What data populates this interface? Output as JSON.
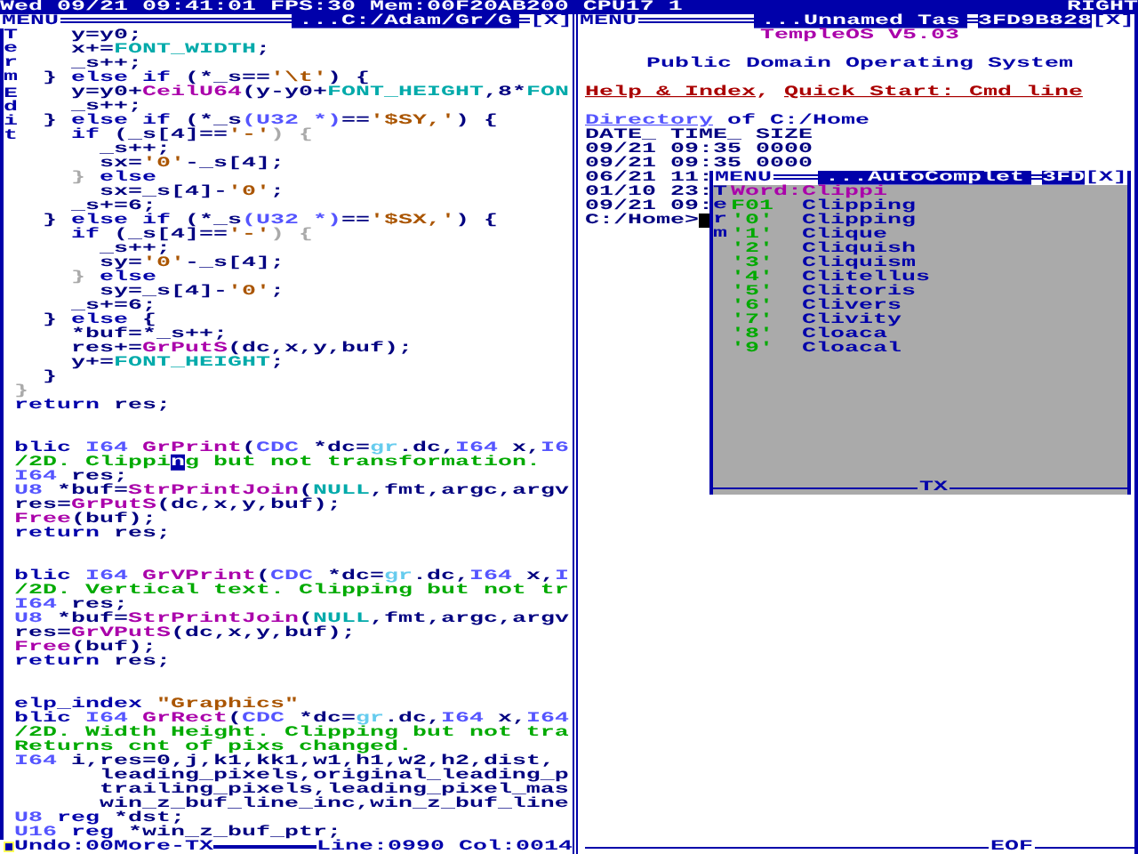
{
  "top_bar": {
    "status": "Wed 09/21 09:41:01 FPS:30 Mem:00F20AB200 CPU17 1",
    "right": "RIGHT"
  },
  "editor_window": {
    "menu": "MENU",
    "title": "...C:/Adam/Gr/G",
    "close": "[X]",
    "side_labels": [
      "Term",
      "Edit"
    ],
    "code_blocks": [
      [
        [
          {
            "text": "    y=y0;",
            "kind": "plain"
          }
        ],
        [
          {
            "text": "    x+=",
            "kind": "plain"
          },
          {
            "text": "FONT_WIDTH",
            "kind": "const"
          },
          {
            "text": ";",
            "kind": "plain"
          }
        ],
        [
          {
            "text": "    _s++;",
            "kind": "plain"
          }
        ],
        [
          {
            "text": "  } ",
            "kind": "plain"
          },
          {
            "text": "else if",
            "kind": "kw"
          },
          {
            "text": " (*_s==",
            "kind": "plain"
          },
          {
            "text": "'\\t'",
            "kind": "str"
          },
          {
            "text": ") {",
            "kind": "plain"
          }
        ],
        [
          {
            "text": "    y=y0+",
            "kind": "plain"
          },
          {
            "text": "CeilU64",
            "kind": "func"
          },
          {
            "text": "(y-y0+",
            "kind": "plain"
          },
          {
            "text": "FONT_HEIGHT",
            "kind": "const"
          },
          {
            "text": ",8*",
            "kind": "plain"
          },
          {
            "text": "FON",
            "kind": "const"
          }
        ],
        [
          {
            "text": "    _s++;",
            "kind": "plain"
          }
        ],
        [
          {
            "text": "  } ",
            "kind": "plain"
          },
          {
            "text": "else if",
            "kind": "kw"
          },
          {
            "text": " (*_s",
            "kind": "plain"
          },
          {
            "text": "(U32 *)",
            "kind": "type"
          },
          {
            "text": "==",
            "kind": "plain"
          },
          {
            "text": "'$SY,'",
            "kind": "str"
          },
          {
            "text": ") {",
            "kind": "plain"
          }
        ],
        [
          {
            "text": "    if",
            "kind": "kw"
          },
          {
            "text": " (_s[4]==",
            "kind": "plain"
          },
          {
            "text": "'-'",
            "kind": "str"
          },
          {
            "text": ") {",
            "kind": "dim"
          }
        ],
        [
          {
            "text": "      _s++;",
            "kind": "plain"
          }
        ],
        [
          {
            "text": "      sx=",
            "kind": "plain"
          },
          {
            "text": "'0'",
            "kind": "str"
          },
          {
            "text": "-_s[4];",
            "kind": "plain"
          }
        ],
        [
          {
            "text": "    } ",
            "kind": "dim"
          },
          {
            "text": "else",
            "kind": "kw"
          }
        ],
        [
          {
            "text": "      sx=_s[4]-",
            "kind": "plain"
          },
          {
            "text": "'0'",
            "kind": "str"
          },
          {
            "text": ";",
            "kind": "plain"
          }
        ],
        [
          {
            "text": "    _s+=6;",
            "kind": "plain"
          }
        ],
        [
          {
            "text": "  } ",
            "kind": "plain"
          },
          {
            "text": "else if",
            "kind": "kw"
          },
          {
            "text": " (*_s",
            "kind": "plain"
          },
          {
            "text": "(U32 *)",
            "kind": "type"
          },
          {
            "text": "==",
            "kind": "plain"
          },
          {
            "text": "'$SX,'",
            "kind": "str"
          },
          {
            "text": ") {",
            "kind": "plain"
          }
        ],
        [
          {
            "text": "    if",
            "kind": "kw"
          },
          {
            "text": " (_s[4]==",
            "kind": "plain"
          },
          {
            "text": "'-'",
            "kind": "str"
          },
          {
            "text": ") {",
            "kind": "dim"
          }
        ],
        [
          {
            "text": "      _s++;",
            "kind": "plain"
          }
        ],
        [
          {
            "text": "      sy=",
            "kind": "plain"
          },
          {
            "text": "'0'",
            "kind": "str"
          },
          {
            "text": "-_s[4];",
            "kind": "plain"
          }
        ],
        [
          {
            "text": "    } ",
            "kind": "dim"
          },
          {
            "text": "else",
            "kind": "kw"
          }
        ],
        [
          {
            "text": "      sy=_s[4]-",
            "kind": "plain"
          },
          {
            "text": "'0'",
            "kind": "str"
          },
          {
            "text": ";",
            "kind": "plain"
          }
        ],
        [
          {
            "text": "    _s+=6;",
            "kind": "plain"
          }
        ],
        [
          {
            "text": "  } ",
            "kind": "plain"
          },
          {
            "text": "else",
            "kind": "kw"
          },
          {
            "text": " {",
            "kind": "plain"
          }
        ],
        [
          {
            "text": "    *buf=*_s++;",
            "kind": "plain"
          }
        ],
        [
          {
            "text": "    res+=",
            "kind": "plain"
          },
          {
            "text": "GrPutS",
            "kind": "func"
          },
          {
            "text": "(dc,x,y,buf);",
            "kind": "plain"
          }
        ],
        [
          {
            "text": "    y+=",
            "kind": "plain"
          },
          {
            "text": "FONT_HEIGHT",
            "kind": "const"
          },
          {
            "text": ";",
            "kind": "plain"
          }
        ],
        [
          {
            "text": "  }",
            "kind": "plain"
          }
        ],
        [
          {
            "text": "}",
            "kind": "dim"
          }
        ],
        [
          {
            "text": "return",
            "kind": "kw"
          },
          {
            "text": " res;",
            "kind": "plain"
          }
        ]
      ],
      [
        [
          {
            "text": "blic ",
            "kind": "kw"
          },
          {
            "text": "I64 ",
            "kind": "type"
          },
          {
            "text": "GrPrint",
            "kind": "func"
          },
          {
            "text": "(",
            "kind": "plain"
          },
          {
            "text": "CDC",
            "kind": "type"
          },
          {
            "text": " *dc=",
            "kind": "plain"
          },
          {
            "text": "gr",
            "kind": "faint"
          },
          {
            "text": ".dc,",
            "kind": "plain"
          },
          {
            "text": "I64",
            "kind": "type"
          },
          {
            "text": " x,",
            "kind": "plain"
          },
          {
            "text": "I6",
            "kind": "type"
          }
        ],
        [
          {
            "text": "/2D. Clippi",
            "kind": "comment"
          },
          {
            "text": "n",
            "kind": "cursor"
          },
          {
            "text": "g but not transformation.",
            "kind": "comment"
          }
        ],
        [
          {
            "text": "I64",
            "kind": "type"
          },
          {
            "text": " res;",
            "kind": "plain"
          }
        ],
        [
          {
            "text": "U8",
            "kind": "type"
          },
          {
            "text": " *buf=",
            "kind": "plain"
          },
          {
            "text": "StrPrintJoin",
            "kind": "func"
          },
          {
            "text": "(",
            "kind": "plain"
          },
          {
            "text": "NULL",
            "kind": "const"
          },
          {
            "text": ",fmt,argc,argv",
            "kind": "plain"
          }
        ],
        [
          {
            "text": "res=",
            "kind": "plain"
          },
          {
            "text": "GrPutS",
            "kind": "func"
          },
          {
            "text": "(dc,x,y,buf);",
            "kind": "plain"
          }
        ],
        [
          {
            "text": "Free",
            "kind": "func"
          },
          {
            "text": "(buf);",
            "kind": "plain"
          }
        ],
        [
          {
            "text": "return",
            "kind": "kw"
          },
          {
            "text": " res;",
            "kind": "plain"
          }
        ]
      ],
      [
        [
          {
            "text": "blic ",
            "kind": "kw"
          },
          {
            "text": "I64 ",
            "kind": "type"
          },
          {
            "text": "GrVPrint",
            "kind": "func"
          },
          {
            "text": "(",
            "kind": "plain"
          },
          {
            "text": "CDC",
            "kind": "type"
          },
          {
            "text": " *dc=",
            "kind": "plain"
          },
          {
            "text": "gr",
            "kind": "faint"
          },
          {
            "text": ".dc,",
            "kind": "plain"
          },
          {
            "text": "I64",
            "kind": "type"
          },
          {
            "text": " x,",
            "kind": "plain"
          },
          {
            "text": "I",
            "kind": "type"
          }
        ],
        [
          {
            "text": "/2D. Vertical text. Clipping but not tr",
            "kind": "comment"
          }
        ],
        [
          {
            "text": "I64",
            "kind": "type"
          },
          {
            "text": " res;",
            "kind": "plain"
          }
        ],
        [
          {
            "text": "U8",
            "kind": "type"
          },
          {
            "text": " *buf=",
            "kind": "plain"
          },
          {
            "text": "StrPrintJoin",
            "kind": "func"
          },
          {
            "text": "(",
            "kind": "plain"
          },
          {
            "text": "NULL",
            "kind": "const"
          },
          {
            "text": ",fmt,argc,argv",
            "kind": "plain"
          }
        ],
        [
          {
            "text": "res=",
            "kind": "plain"
          },
          {
            "text": "GrVPutS",
            "kind": "func"
          },
          {
            "text": "(dc,x,y,buf);",
            "kind": "plain"
          }
        ],
        [
          {
            "text": "Free",
            "kind": "func"
          },
          {
            "text": "(buf);",
            "kind": "plain"
          }
        ],
        [
          {
            "text": "return",
            "kind": "kw"
          },
          {
            "text": " res;",
            "kind": "plain"
          }
        ]
      ],
      [
        [
          {
            "text": "elp_index ",
            "kind": "kw"
          },
          {
            "text": "\"Graphics\"",
            "kind": "str"
          }
        ],
        [
          {
            "text": "blic ",
            "kind": "kw"
          },
          {
            "text": "I64 ",
            "kind": "type"
          },
          {
            "text": "GrRect",
            "kind": "func"
          },
          {
            "text": "(",
            "kind": "plain"
          },
          {
            "text": "CDC",
            "kind": "type"
          },
          {
            "text": " *dc=",
            "kind": "plain"
          },
          {
            "text": "gr",
            "kind": "faint"
          },
          {
            "text": ".dc,",
            "kind": "plain"
          },
          {
            "text": "I64",
            "kind": "type"
          },
          {
            "text": " x,",
            "kind": "plain"
          },
          {
            "text": "I64",
            "kind": "type"
          }
        ],
        [
          {
            "text": "/2D. Width Height. Clipping but not tra",
            "kind": "comment"
          }
        ],
        [
          {
            "text": "Returns cnt of pixs changed.",
            "kind": "comment"
          }
        ],
        [
          {
            "text": "I64",
            "kind": "type"
          },
          {
            "text": " i,res=0,j,k1,kk1,w1,h1,w2,h2,dist,",
            "kind": "plain"
          }
        ],
        [
          {
            "text": "      leading_pixels,original_leading_p",
            "kind": "plain"
          }
        ],
        [
          {
            "text": "      trailing_pixels,leading_pixel_mas",
            "kind": "plain"
          }
        ],
        [
          {
            "text": "      win_z_buf_line_inc,win_z_buf_line",
            "kind": "plain"
          }
        ],
        [
          {
            "text": "U8 ",
            "kind": "type"
          },
          {
            "text": "reg",
            "kind": "kw"
          },
          {
            "text": " *dst;",
            "kind": "plain"
          }
        ],
        [
          {
            "text": "U16 ",
            "kind": "type"
          },
          {
            "text": "reg",
            "kind": "kw"
          },
          {
            "text": " *win_z_buf_ptr;",
            "kind": "plain"
          }
        ]
      ]
    ],
    "status_left": "Undo:00More-TX",
    "status_right": "Line:0990 Col:0014"
  },
  "terminal_window": {
    "menu": "MENU",
    "title": "...Unnamed Tas",
    "task_id": "3FD9B828",
    "close": "[X]",
    "banner_title": "TempleOS V5.03",
    "banner_subtitle": "Public Domain Operating System",
    "links": [
      {
        "kind": "link",
        "text": "Help & Index"
      },
      {
        "kind": "plain",
        "text": ","
      },
      {
        "kind": "link",
        "text": "Quick Start: Cmd line"
      }
    ],
    "directory_link": "Directory",
    "directory_path": "of C:/Home",
    "listing_header": "DATE_ TIME_ SIZE",
    "listing_rows": [
      "09/21 09:35 0000",
      "09/21 09:35 0000",
      "06/21 11:",
      "01/10 23:",
      "09/21 09:"
    ],
    "prompt": "C:/Home>",
    "footer": "EOF"
  },
  "autocomplete_popup": {
    "menu": "MENU",
    "title": "...AutoComplet",
    "task_id": "3FD",
    "close": "[X]",
    "side_label": "Term",
    "word": "Word:Clippi",
    "entries": [
      {
        "key": "F01",
        "word": "Clipping"
      },
      {
        "key": "'0'",
        "word": "Clipping"
      },
      {
        "key": "'1'",
        "word": "Clique"
      },
      {
        "key": "'2'",
        "word": "Cliquish"
      },
      {
        "key": "'3'",
        "word": "Cliquism"
      },
      {
        "key": "'4'",
        "word": "Clitellus"
      },
      {
        "key": "'5'",
        "word": "Clitoris"
      },
      {
        "key": "'6'",
        "word": "Clivers"
      },
      {
        "key": "'7'",
        "word": "Clivity"
      },
      {
        "key": "'8'",
        "word": "Cloaca"
      },
      {
        "key": "'9'",
        "word": "Cloacal"
      }
    ],
    "footer": "TX"
  }
}
